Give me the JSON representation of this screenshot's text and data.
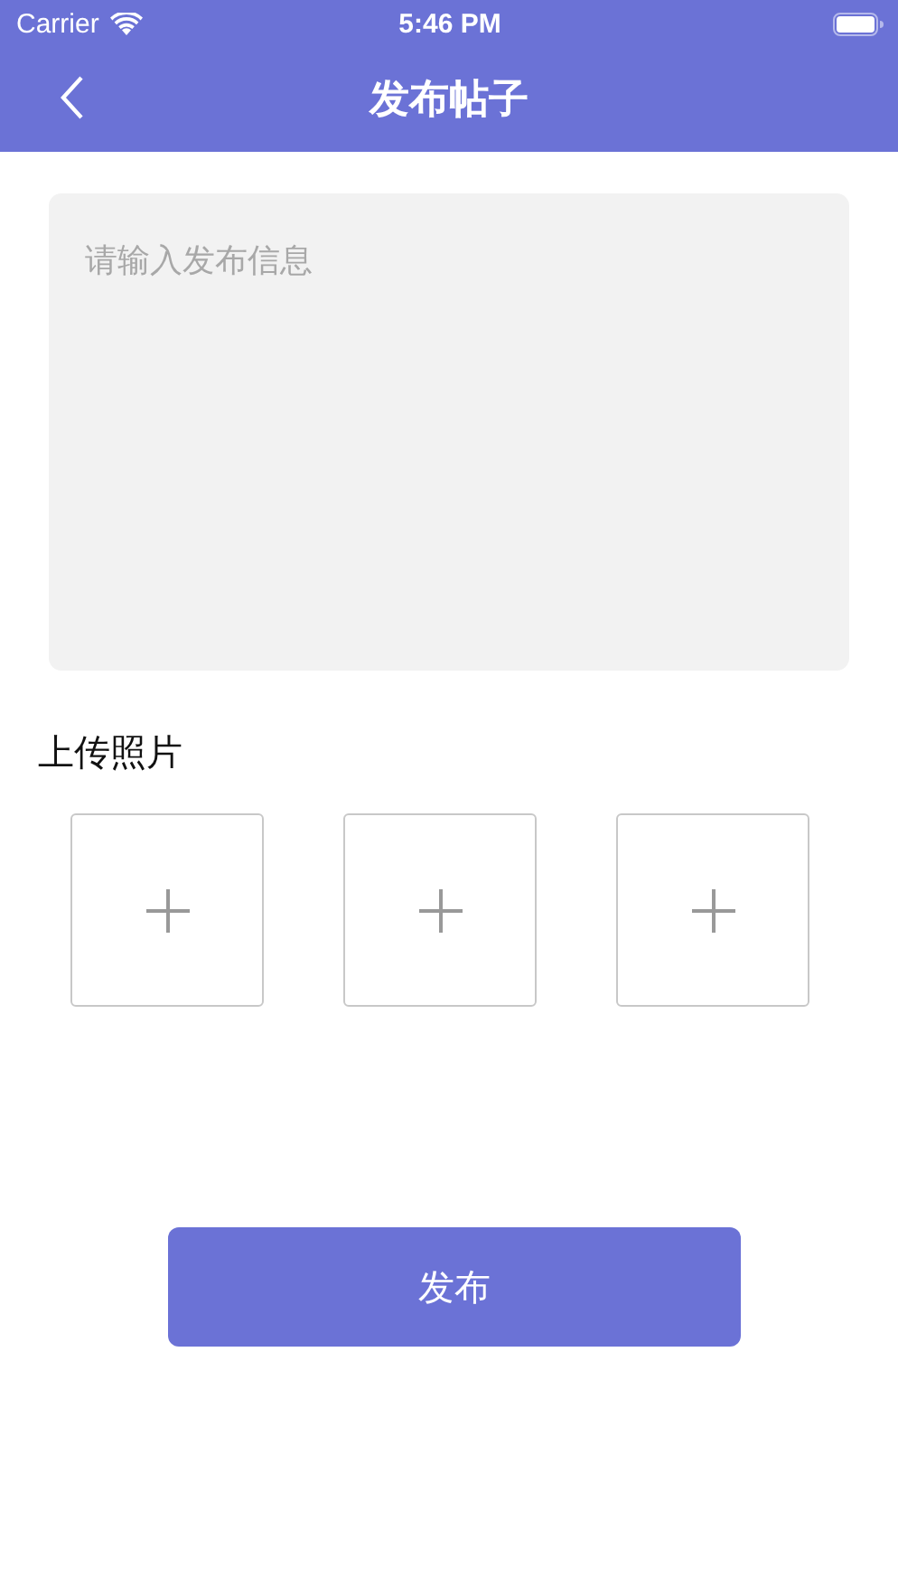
{
  "status_bar": {
    "carrier": "Carrier",
    "time": "5:46 PM"
  },
  "nav_bar": {
    "title": "发布帖子"
  },
  "post_field": {
    "placeholder": "请输入发布信息"
  },
  "upload": {
    "label": "上传照片",
    "slots": [
      {
        "kind": "add"
      },
      {
        "kind": "add"
      },
      {
        "kind": "add"
      }
    ]
  },
  "submit_button": {
    "label": "发布"
  }
}
